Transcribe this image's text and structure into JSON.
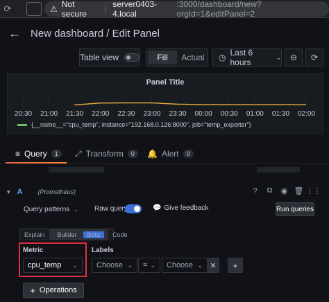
{
  "browser": {
    "security_label": "Not secure",
    "url_host": "server0403-4.local",
    "url_rest": ":3000/dashboard/new?orgId=1&editPanel=2"
  },
  "header": {
    "title": "New dashboard / Edit Panel"
  },
  "toolbar": {
    "table_view_label": "Table view",
    "table_view_enabled": false,
    "fill_label": "Fill",
    "actual_label": "Actual",
    "selected_mode": "Fill",
    "time_range_label": "Last 6 hours"
  },
  "panel": {
    "title": "Panel Title",
    "x_ticks": [
      "20:30",
      "21:00",
      "21:30",
      "22:00",
      "22:30",
      "23:00",
      "23:30",
      "00:00",
      "00:30",
      "01:00",
      "01:30",
      "02:00"
    ],
    "legend": "{__name__=\"cpu_temp\", instance=\"192.168.0.126:8000\", job=\"temp_exporter\"}"
  },
  "chart_data": {
    "type": "line",
    "title": "Panel Title",
    "x": [
      "20:30",
      "21:00",
      "21:30",
      "22:00",
      "22:30",
      "23:00",
      "23:30",
      "00:00",
      "00:30",
      "01:00",
      "01:30",
      "02:00"
    ],
    "series": [
      {
        "name": "{__name__=\"cpu_temp\", instance=\"192.168.0.126:8000\", job=\"temp_exporter\"}",
        "color": "#e0a73d",
        "values": [
          null,
          null,
          0.45,
          0.8,
          0.85,
          0.85,
          0.6,
          0.5,
          0.5,
          0.5,
          0.5,
          0.5
        ]
      }
    ],
    "grid": true
  },
  "tabs": [
    {
      "label": "Query",
      "count": "1",
      "active": true
    },
    {
      "label": "Transform",
      "count": "0",
      "active": false
    },
    {
      "label": "Alert",
      "count": "0",
      "active": false
    }
  ],
  "query": {
    "ref_id": "A",
    "datasource": "(Prometheus)",
    "patterns_label": "Query patterns",
    "raw_query_label": "Raw query",
    "raw_query_enabled": true,
    "feedback_label": "Give feedback",
    "run_label": "Run queries",
    "modes": [
      "Explain",
      "Builder",
      "Code"
    ],
    "active_mode": "Builder",
    "beta_label": "Beta",
    "metric_label": "Metric",
    "metric_value": "cpu_temp",
    "labels_label": "Labels",
    "label_key_placeholder": "Choose",
    "label_op": "=",
    "label_value_placeholder": "Choose",
    "operations_label": "Operations"
  },
  "colors": {
    "accent": "#3d71d9",
    "tab_underline": "#f55f3e",
    "highlight_box": "#e02f44",
    "series": "#e0a73d"
  }
}
